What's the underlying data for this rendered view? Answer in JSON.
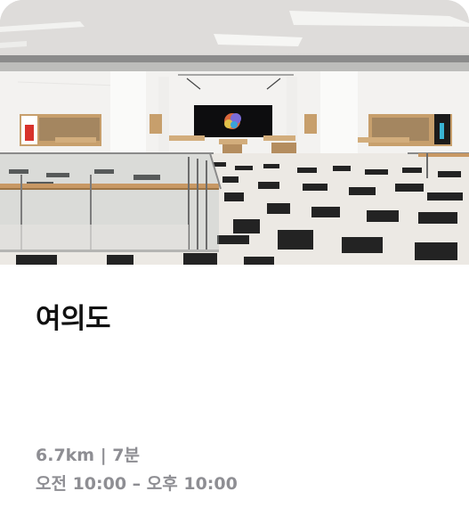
{
  "store": {
    "name": "여의도",
    "distance": "6.7km | 7분",
    "hours": "오전 10:00 – 오후 10:00"
  },
  "colors": {
    "title": "#111111",
    "meta": "#8e8e93",
    "card": "#ffffff"
  }
}
